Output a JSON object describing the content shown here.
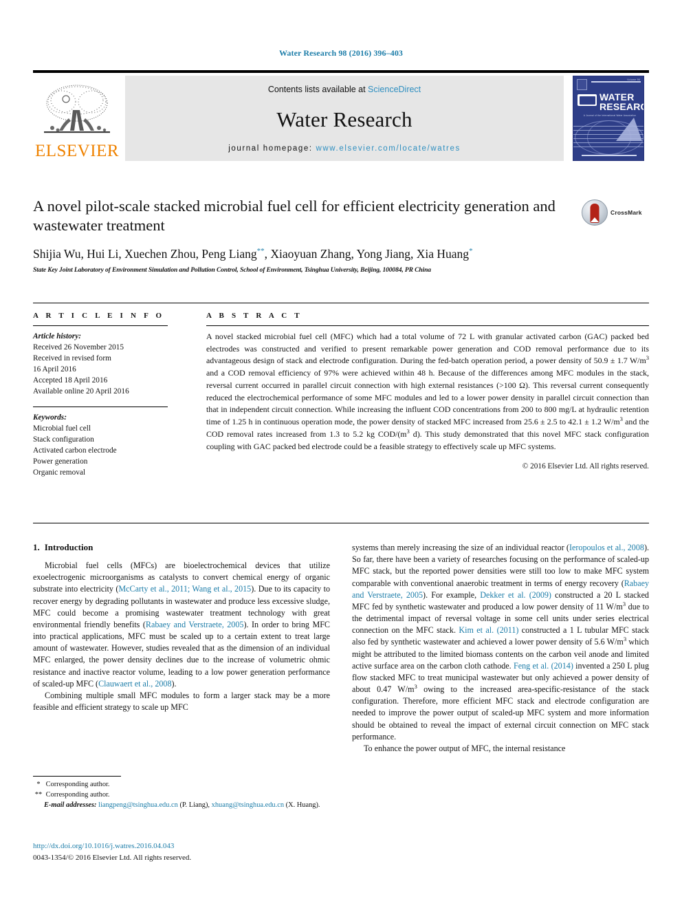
{
  "running_head": "Water Research 98 (2016) 396–403",
  "masthead": {
    "publisher_wordmark": "ELSEVIER",
    "contents_prefix": "Contents lists available at ",
    "contents_link": "ScienceDirect",
    "journal_title": "Water Research",
    "homepage_prefix": "journal homepage: ",
    "homepage_url": "www.elsevier.com/locate/watres",
    "cover": {
      "title_line1": "WATER",
      "title_line2": "RESEARCH",
      "society_badge": "IWA",
      "volume_label": "Volume 98",
      "subtitle": "A Journal of the International Water Association"
    }
  },
  "article": {
    "title": "A novel pilot-scale stacked microbial fuel cell for efficient electricity generation and wastewater treatment",
    "crossmark_label": "CrossMark",
    "authors_html": "Shijia Wu, Hui Li, Xuechen Zhou, Peng Liang<sup>**</sup>, Xiaoyuan Zhang, Yong Jiang, Xia Huang<sup>*</sup>",
    "affiliation": "State Key Joint Laboratory of Environment Simulation and Pollution Control, School of Environment, Tsinghua University, Beijing, 100084, PR China"
  },
  "article_info": {
    "heading": "A R T I C L E   I N F O",
    "history_label": "Article history:",
    "history": [
      "Received 26 November 2015",
      "Received in revised form",
      "16 April 2016",
      "Accepted 18 April 2016",
      "Available online 20 April 2016"
    ],
    "keywords_label": "Keywords:",
    "keywords": [
      "Microbial fuel cell",
      "Stack configuration",
      "Activated carbon electrode",
      "Power generation",
      "Organic removal"
    ]
  },
  "abstract": {
    "heading": "A B S T R A C T",
    "text_html": "A novel stacked microbial fuel cell (MFC) which had a total volume of 72 L with granular activated carbon (GAC) packed bed electrodes was constructed and verified to present remarkable power generation and COD removal performance due to its advantageous design of stack and electrode configuration. During the fed-batch operation period, a power density of 50.9 ± 1.7 W/m<sup class=\"s\">3</sup> and a COD removal efficiency of 97% were achieved within 48 h. Because of the differences among MFC modules in the stack, reversal current occurred in parallel circuit connection with high external resistances (&gt;100 Ω). This reversal current consequently reduced the electrochemical performance of some MFC modules and led to a lower power density in parallel circuit connection than that in independent circuit connection. While increasing the influent COD concentrations from 200 to 800 mg/L at hydraulic retention time of 1.25 h in continuous operation mode, the power density of stacked MFC increased from 25.6 ± 2.5 to 42.1 ± 1.2 W/m<sup class=\"s\">3</sup> and the COD removal rates increased from 1.3 to 5.2 kg COD/(m<sup class=\"s\">3</sup> d). This study demonstrated that this novel MFC stack configuration coupling with GAC packed bed electrode could be a feasible strategy to effectively scale up MFC systems.",
    "copyright": "© 2016 Elsevier Ltd. All rights reserved."
  },
  "body": {
    "section_number": "1.",
    "section_title": "Introduction",
    "left_paragraphs_html": [
      "Microbial fuel cells (MFCs) are bioelectrochemical devices that utilize exoelectrogenic microorganisms as catalysts to convert chemical energy of organic substrate into electricity (<span class=\"ref\">McCarty et al., 2011; Wang et al., 2015</span>). Due to its capacity to recover energy by degrading pollutants in wastewater and produce less excessive sludge, MFC could become a promising wastewater treatment technology with great environmental friendly benefits (<span class=\"ref\">Rabaey and Verstraete, 2005</span>). In order to bring MFC into practical applications, MFC must be scaled up to a certain extent to treat large amount of wastewater. However, studies revealed that as the dimension of an individual MFC enlarged, the power density declines due to the increase of volumetric ohmic resistance and inactive reactor volume, leading to a low power generation performance of scaled-up MFC (<span class=\"ref\">Clauwaert et al., 2008</span>).",
      "Combining multiple small MFC modules to form a larger stack may be a more feasible and efficient strategy to scale up MFC"
    ],
    "right_paragraphs_html": [
      "systems than merely increasing the size of an individual reactor (<span class=\"ref\">Ieropoulos et al., 2008</span>). So far, there have been a variety of researches focusing on the performance of scaled-up MFC stack, but the reported power densities were still too low to make MFC system comparable with conventional anaerobic treatment in terms of energy recovery (<span class=\"ref\">Rabaey and Verstraete, 2005</span>). For example, <span class=\"ref\">Dekker et al. (2009)</span> constructed a 20 L stacked MFC fed by synthetic wastewater and produced a low power density of 11 W/m<sup class=\"s\">3</sup> due to the detrimental impact of reversal voltage in some cell units under series electrical connection on the MFC stack. <span class=\"ref\">Kim et al. (2011)</span> constructed a 1 L tubular MFC stack also fed by synthetic wastewater and achieved a lower power density of 5.6 W/m<sup class=\"s\">3</sup> which might be attributed to the limited biomass contents on the carbon veil anode and limited active surface area on the carbon cloth cathode. <span class=\"ref\">Feng et al. (2014)</span> invented a 250 L plug flow stacked MFC to treat municipal wastewater but only achieved a power density of about 0.47 W/m<sup class=\"s\">3</sup> owing to the increased area-specific-resistance of the stack configuration. Therefore, more efficient MFC stack and electrode configuration are needed to improve the power output of scaled-up MFC system and more information should be obtained to reveal the impact of external circuit connection on MFC stack performance.",
      "To enhance the power output of MFC, the internal resistance"
    ]
  },
  "footnotes": {
    "items_html": [
      "<span class=\"star\">*</span> Corresponding author.",
      "<span class=\"star\">**</span> Corresponding author."
    ],
    "email_label": "E-mail addresses:",
    "emails_html": " <span class=\"link\">liangpeng@tsinghua.edu.cn</span> (P. Liang), <span class=\"link\">xhuang@tsinghua.edu.cn</span> (X. Huang)."
  },
  "footer": {
    "doi": "http://dx.doi.org/10.1016/j.watres.2016.04.043",
    "issn_line": "0043-1354/© 2016 Elsevier Ltd. All rights reserved."
  },
  "colors": {
    "link": "#1b7ca8",
    "elsevier_orange": "#ef8200",
    "cover_blue": "#2e3e88"
  }
}
